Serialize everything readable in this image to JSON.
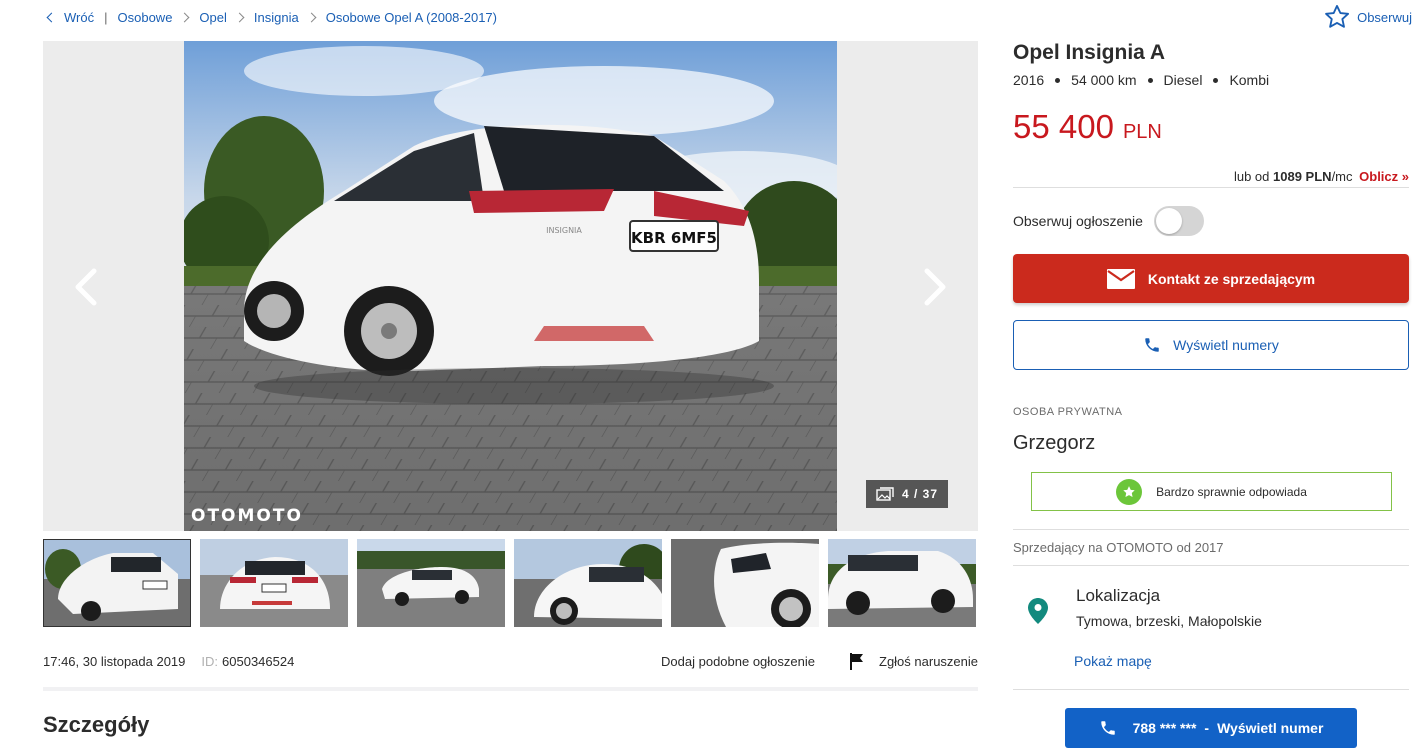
{
  "breadcrumb": {
    "back": "Wróć",
    "items": [
      "Osobowe",
      "Opel",
      "Insignia",
      "Osobowe Opel A (2008-2017)"
    ]
  },
  "watch_top": {
    "label": "Obserwuj",
    "icon": "star-outline-icon"
  },
  "gallery": {
    "watermark": "OTOMOTO",
    "counter": "4 / 37",
    "plate": "KBR 6MF5",
    "badge_text": "INSIGNIA",
    "thumbnail_count": 6
  },
  "meta": {
    "date": "17:46, 30 listopada 2019",
    "id_label": "ID:",
    "id_value": "6050346524",
    "add_similar": "Dodaj podobne ogłoszenie",
    "report": "Zgłoś naruszenie"
  },
  "details": {
    "title": "Szczegóły"
  },
  "offer": {
    "title": "Opel Insignia A",
    "params": [
      "2016",
      "54 000 km",
      "Diesel",
      "Kombi"
    ],
    "price": "55 400",
    "currency": "PLN",
    "finance_prefix": "lub od",
    "finance_amount": "1089 PLN",
    "finance_suffix": "/mc",
    "finance_calc": "Oblicz »",
    "observe_label": "Obserwuj ogłoszenie",
    "contact_button": "Kontakt ze sprzedającym",
    "phone_button": "Wyświetl numery"
  },
  "seller": {
    "type": "OSOBA PRYWATNA",
    "name": "Grzegorz",
    "badge": "Bardzo sprawnie odpowiada",
    "since": "Sprzedający na OTOMOTO od 2017",
    "location_title": "Lokalizacja",
    "location_value": "Tymowa, brzeski, Małopolskie",
    "map_link": "Pokaż mapę",
    "phone_masked": "788 *** ***",
    "phone_action": "Wyświetl numer"
  },
  "colors": {
    "link": "#1a5fb4",
    "price": "#c8181e",
    "contact_bg": "#cb2a1d",
    "phone_bg": "#1262c7",
    "badge_border": "#83c247"
  }
}
